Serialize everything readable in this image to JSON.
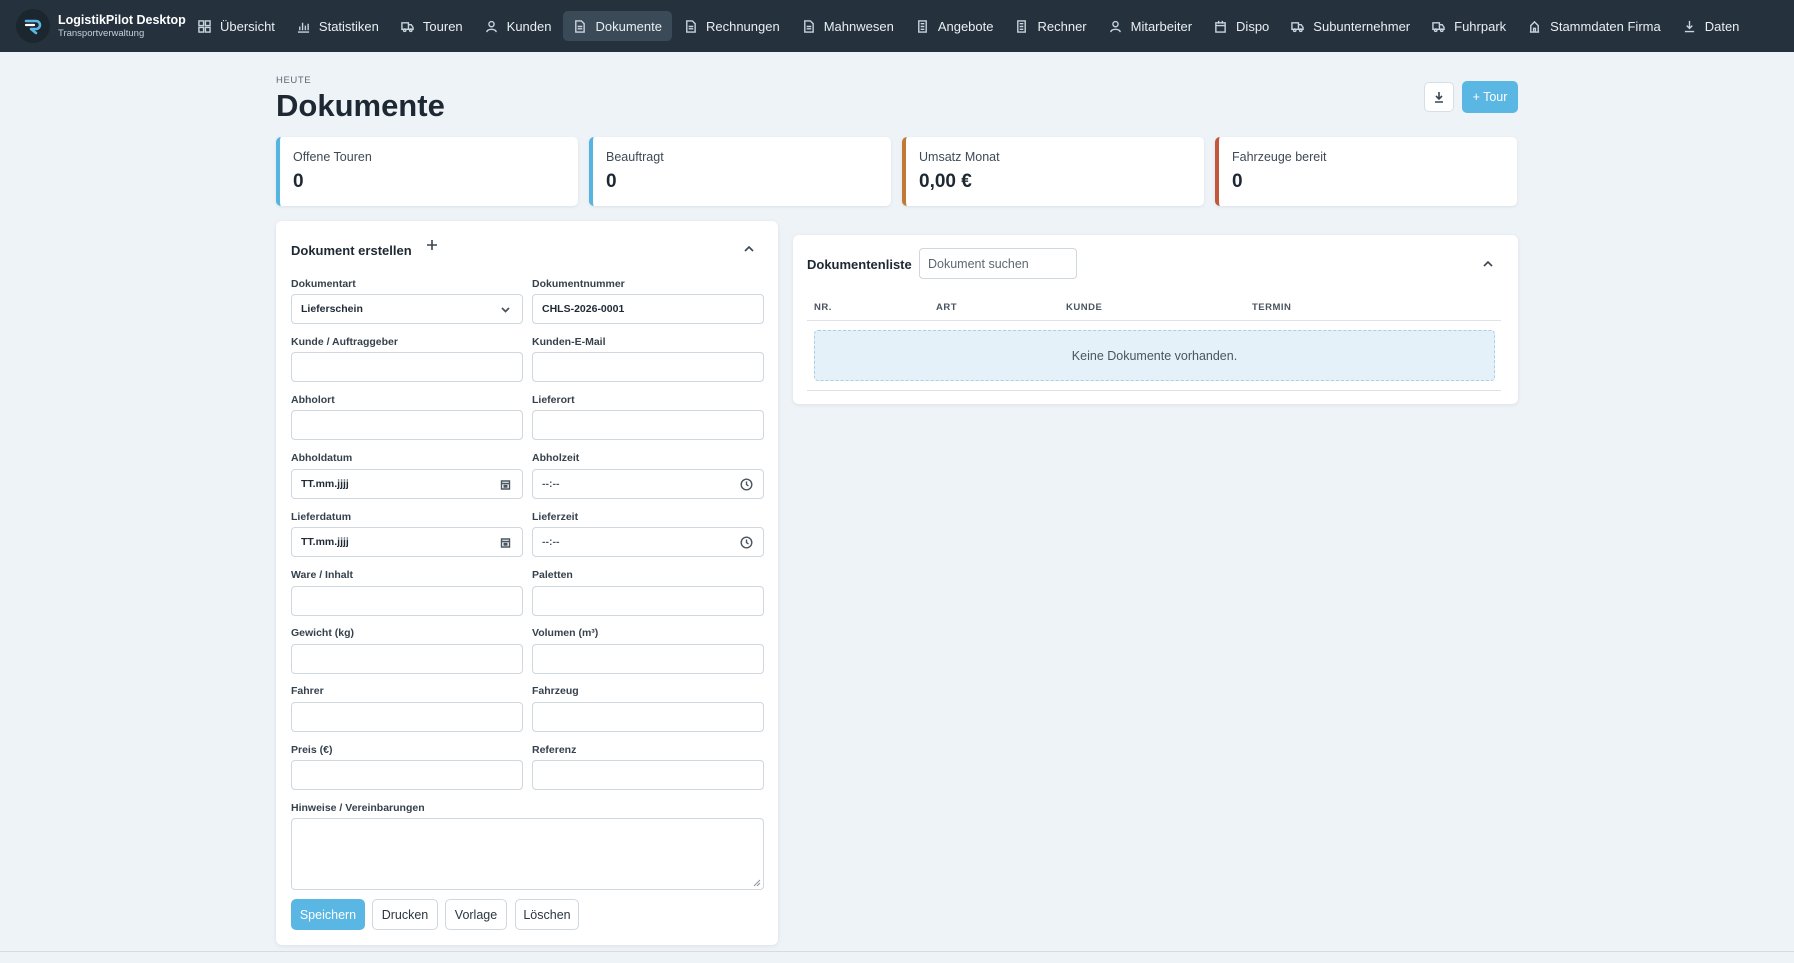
{
  "app": {
    "title": "LogistikPilot Desktop",
    "subtitle": "Transportverwaltung"
  },
  "nav": [
    {
      "label": "Übersicht",
      "icon": "grid-icon"
    },
    {
      "label": "Statistiken",
      "icon": "bar-chart-icon"
    },
    {
      "label": "Touren",
      "icon": "truck-icon"
    },
    {
      "label": "Kunden",
      "icon": "user-icon"
    },
    {
      "label": "Dokumente",
      "icon": "document-icon",
      "active": true
    },
    {
      "label": "Rechnungen",
      "icon": "document-icon"
    },
    {
      "label": "Mahnwesen",
      "icon": "document-icon"
    },
    {
      "label": "Angebote",
      "icon": "document-icon"
    },
    {
      "label": "Rechner",
      "icon": "document-icon"
    },
    {
      "label": "Mitarbeiter",
      "icon": "user-icon"
    },
    {
      "label": "Dispo",
      "icon": "calendar-icon"
    },
    {
      "label": "Subunternehmer",
      "icon": "truck-icon"
    },
    {
      "label": "Fuhrpark",
      "icon": "truck-icon"
    },
    {
      "label": "Stammdaten Firma",
      "icon": "building-icon"
    },
    {
      "label": "Daten",
      "icon": "download-icon"
    }
  ],
  "header": {
    "kicker": "HEUTE",
    "title": "Dokumente",
    "tour_button": "+ Tour"
  },
  "stats": [
    {
      "label": "Offene Touren",
      "value": "0",
      "color": "#55b5e0"
    },
    {
      "label": "Beauftragt",
      "value": "0",
      "color": "#55b5e0"
    },
    {
      "label": "Umsatz Monat",
      "value": "0,00 €",
      "color": "#c07a33"
    },
    {
      "label": "Fahrzeuge bereit",
      "value": "0",
      "color": "#c2573b"
    }
  ],
  "form": {
    "title": "Dokument erstellen",
    "doctype_label": "Dokumentart",
    "doctype_value": "Lieferschein",
    "docnum_label": "Dokumentnummer",
    "docnum_value": "CHLS-2026-0001",
    "kunde_label": "Kunde / Auftraggeber",
    "email_label": "Kunden-E-Mail",
    "abholort_label": "Abholort",
    "lieferort_label": "Lieferort",
    "abholdatum_label": "Abholdatum",
    "abholdatum_value": "TT.mm.jjjj",
    "abholzeit_label": "Abholzeit",
    "abholzeit_value": "--:--",
    "lieferdatum_label": "Lieferdatum",
    "lieferdatum_value": "TT.mm.jjjj",
    "lieferzeit_label": "Lieferzeit",
    "lieferzeit_value": "--:--",
    "ware_label": "Ware / Inhalt",
    "paletten_label": "Paletten",
    "gewicht_label": "Gewicht (kg)",
    "volumen_label": "Volumen (m³)",
    "fahrer_label": "Fahrer",
    "fahrzeug_label": "Fahrzeug",
    "preis_label": "Preis (€)",
    "referenz_label": "Referenz",
    "hinweise_label": "Hinweise / Vereinbarungen",
    "buttons": {
      "save": "Speichern",
      "print": "Drucken",
      "template": "Vorlage",
      "delete": "Löschen"
    }
  },
  "list": {
    "title": "Dokumentenliste",
    "search_placeholder": "Dokument suchen",
    "columns": [
      "NR.",
      "ART",
      "KUNDE",
      "TERMIN"
    ],
    "empty": "Keine Dokumente vorhanden."
  }
}
